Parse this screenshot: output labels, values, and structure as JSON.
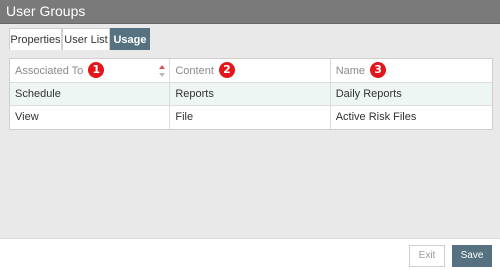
{
  "window": {
    "title": "User Groups"
  },
  "tabs": [
    {
      "label": "Properties"
    },
    {
      "label": "User List"
    },
    {
      "label": "Usage",
      "active": true
    }
  ],
  "grid": {
    "columns": [
      {
        "label": "Associated To",
        "marker": "1",
        "sort_icon": "sort-up-down-icon"
      },
      {
        "label": "Content",
        "marker": "2"
      },
      {
        "label": "Name",
        "marker": "3"
      }
    ],
    "rows": [
      [
        "Schedule",
        "Reports",
        "Daily Reports"
      ],
      [
        "View",
        "File",
        "Active Risk Files"
      ]
    ]
  },
  "buttons": {
    "exit": "Exit",
    "save": "Save"
  },
  "colors": {
    "title_bar": "#7a7a7a",
    "accent": "#56717f",
    "marker": "#e3161b",
    "row_highlight": "#eef6f4"
  }
}
